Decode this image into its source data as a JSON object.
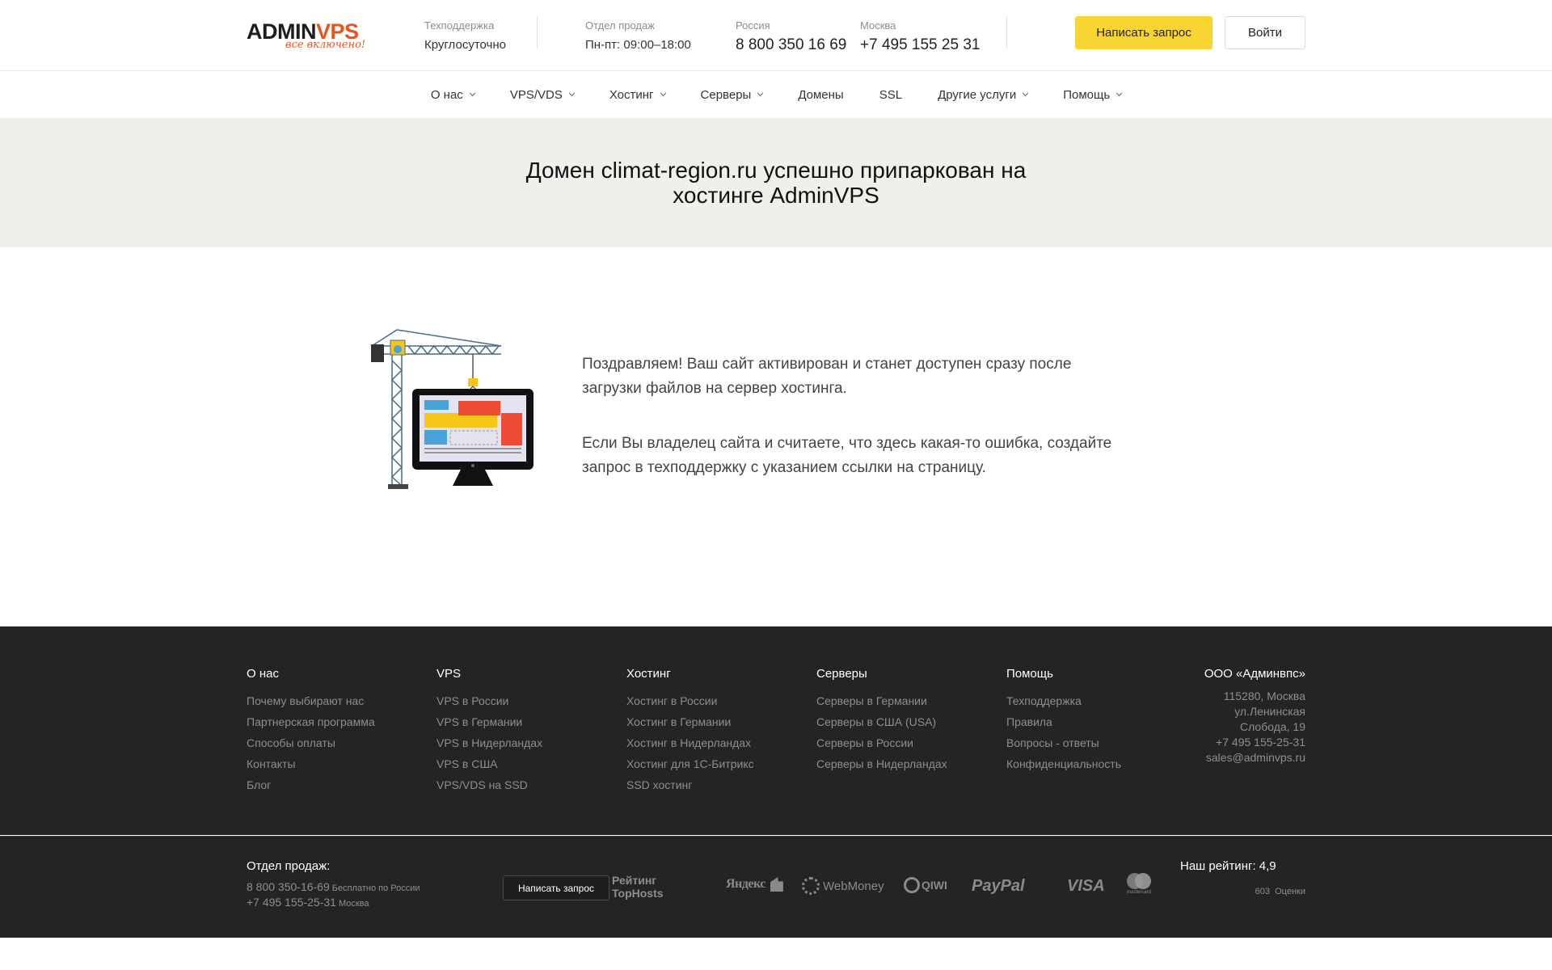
{
  "header": {
    "logo": {
      "main": "ADMINVPS",
      "tagline": "все включено!"
    },
    "support": {
      "label": "Техподдержка",
      "value": "Круглосуточно"
    },
    "sales": {
      "label": "Отдел продаж",
      "value": "Пн-пт: 09:00–18:00"
    },
    "russia": {
      "label": "Россия",
      "phone": "8 800 350 16 69"
    },
    "moscow": {
      "label": "Москва",
      "phone": "+7 495 155 25 31"
    },
    "request_button": "Написать запрос",
    "login_button": "Войти"
  },
  "nav": [
    {
      "label": "О нас",
      "dropdown": true
    },
    {
      "label": "VPS/VDS",
      "dropdown": true
    },
    {
      "label": "Хостинг",
      "dropdown": true
    },
    {
      "label": "Серверы",
      "dropdown": true
    },
    {
      "label": "Домены",
      "dropdown": false
    },
    {
      "label": "SSL",
      "dropdown": false
    },
    {
      "label": "Другие услуги",
      "dropdown": true
    },
    {
      "label": "Помощь",
      "dropdown": true
    }
  ],
  "banner": {
    "title": "Домен climat-region.ru успешно припаркован на хостинге AdminVPS"
  },
  "main": {
    "paragraph1": "Поздравляем! Ваш сайт активирован и станет доступен сразу после загрузки файлов на сервер хостинга.",
    "paragraph2": "Если Вы владелец сайта и считаете, что здесь какая-то ошибка, создайте запрос в техподдержку с указанием ссылки на страницу."
  },
  "footer": {
    "columns": [
      {
        "title": "О нас",
        "links": [
          "Почему выбирают нас",
          "Партнерская программа",
          "Способы оплаты",
          "Контакты",
          "Блог"
        ]
      },
      {
        "title": "VPS",
        "links": [
          "VPS в России",
          "VPS в Германии",
          "VPS в Нидерландах",
          "VPS в США",
          "VPS/VDS на SSD"
        ]
      },
      {
        "title": "Хостинг",
        "links": [
          "Хостинг в России",
          "Хостинг в Германии",
          "Хостинг в Нидерландах",
          "Хостинг для 1С-Битрикс",
          "SSD хостинг"
        ]
      },
      {
        "title": "Серверы",
        "links": [
          "Серверы в Германии",
          "Серверы в США (USA)",
          "Серверы в России",
          "Серверы в Нидерландах"
        ]
      },
      {
        "title": "Помощь",
        "links": [
          "Техподдержка",
          "Правила",
          "Вопросы - ответы",
          "Конфиденциальность"
        ]
      }
    ],
    "company": {
      "title": "ООО «Админвпс»",
      "address_lines": [
        "115280, Москва",
        "ул.Ленинская",
        "Слобода, 19",
        "+7 495 155-25-31",
        "sales@adminvps.ru"
      ]
    },
    "sales": {
      "title": "Отдел продаж:",
      "phone1": "8 800 350-16-69",
      "phone1_note": "Бесплатно по России",
      "phone2": "+7 495 155-25-31",
      "phone2_note": "Москва"
    },
    "request_button": "Написать запрос",
    "toprating": {
      "line1": "Рейтинг",
      "line2": "TopHosts"
    },
    "payments": [
      "Яндекс",
      "WebMoney",
      "QIWI",
      "PayPal",
      "VISA",
      "mastercard"
    ],
    "rating": {
      "title": "Наш рейтинг: 4,9",
      "count": "603",
      "count_label": "Оценки"
    }
  }
}
